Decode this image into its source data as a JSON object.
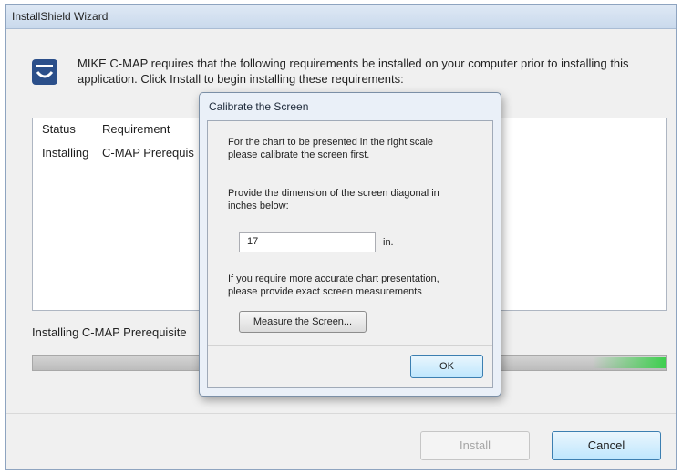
{
  "window": {
    "title": "InstallShield Wizard"
  },
  "header": {
    "icon": "installshield-icon",
    "message": "MIKE C-MAP requires that the following requirements be installed on your computer prior to installing this application. Click Install to begin installing these requirements:"
  },
  "requirements": {
    "columns": [
      "Status",
      "Requirement"
    ],
    "rows": [
      {
        "status": "Installing",
        "requirement": "C-MAP Prerequis"
      }
    ]
  },
  "progress": {
    "label": "Installing C-MAP Prerequisite",
    "fraction": 1.0
  },
  "buttons": {
    "install": "Install",
    "cancel": "Cancel"
  },
  "dialog": {
    "title": "Calibrate the Screen",
    "intro_line1": "For the chart to be presented in the right scale",
    "intro_line2": "please calibrate the screen first.",
    "prompt_line1": "Provide the dimension of the screen diagonal in",
    "prompt_line2": "inches below:",
    "diagonal_value": "17",
    "unit": "in.",
    "accuracy_line1": "If you require more accurate chart presentation,",
    "accuracy_line2": "please provide exact screen measurements",
    "measure_button": "Measure the Screen...",
    "ok_button": "OK"
  },
  "colors": {
    "accent": "#3c7fb1",
    "progress_glow": "#3fcf4f",
    "icon_bg": "#2b4f8a"
  }
}
